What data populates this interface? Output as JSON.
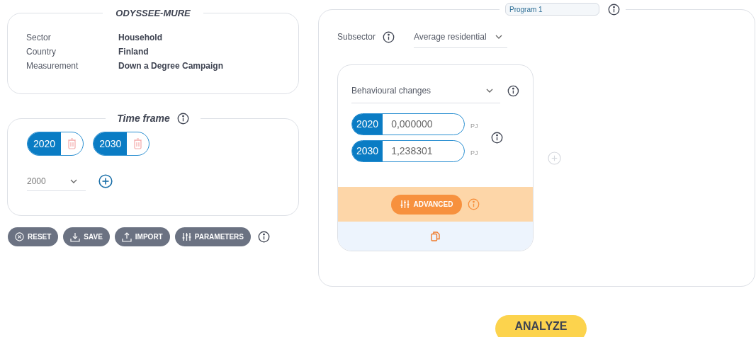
{
  "info_card": {
    "title": "ODYSSEE-MURE",
    "rows": [
      {
        "label": "Sector",
        "value": "Household"
      },
      {
        "label": "Country",
        "value": "Finland"
      },
      {
        "label": "Measurement",
        "value": "Down a Degree Campaign"
      }
    ]
  },
  "time_frame": {
    "title": "Time frame",
    "years": [
      "2020",
      "2030"
    ],
    "year_select": {
      "value": "2000"
    }
  },
  "actions": [
    "RESET",
    "SAVE",
    "IMPORT",
    "PARAMETERS"
  ],
  "program": {
    "name": "Program 1",
    "subsector_label": "Subsector",
    "subsector": "Average residential",
    "measure": {
      "type": "Behavioural changes",
      "entries": [
        {
          "year": "2020",
          "value": "0,000000",
          "unit": "PJ"
        },
        {
          "year": "2030",
          "value": "1,238301",
          "unit": "PJ"
        }
      ],
      "advanced_button": "ADVANCED"
    }
  },
  "analyze_button": "ANALYZE"
}
